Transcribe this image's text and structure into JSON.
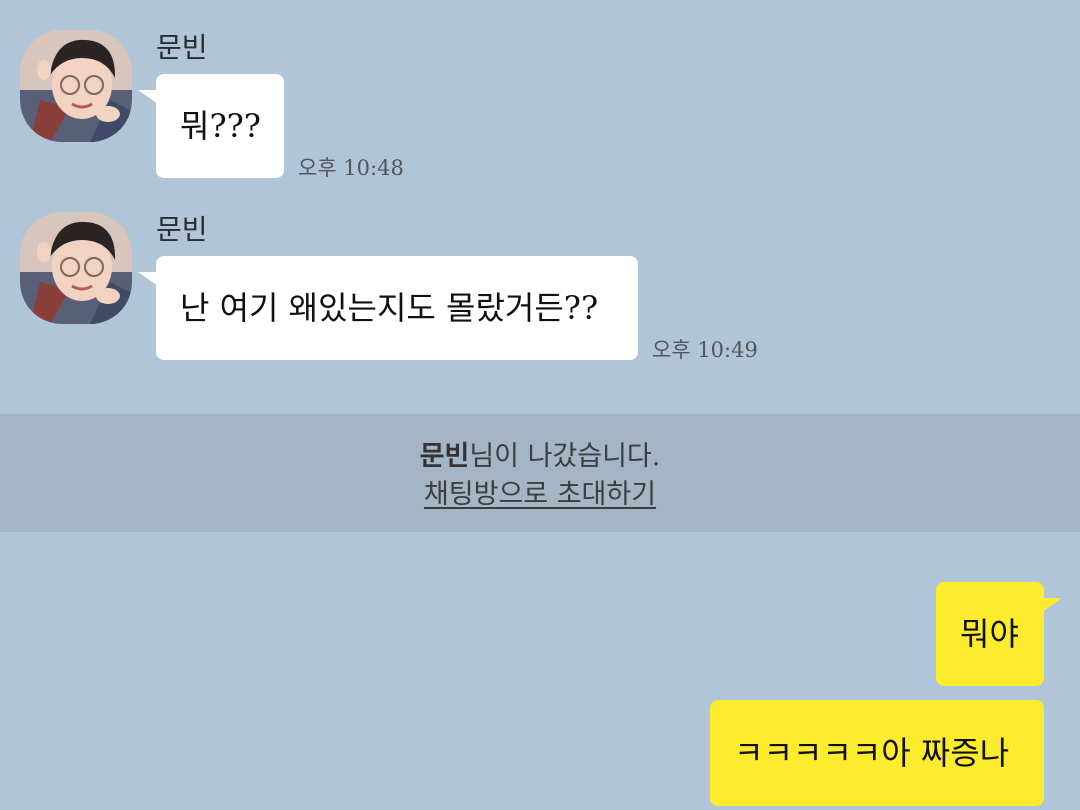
{
  "messages": [
    {
      "sender": "문빈",
      "text": "뭐???",
      "time": "오후 10:48"
    },
    {
      "sender": "문빈",
      "text": "난 여기 왜있는지도 몰랐거든??",
      "time": "오후 10:49"
    }
  ],
  "system_notice": {
    "name": "문빈",
    "suffix": "님이 나갔습니다.",
    "invite_label": "채팅방으로 초대하기"
  },
  "my_messages": [
    {
      "text": "뭐야"
    },
    {
      "text": "ㅋㅋㅋㅋㅋ아 짜증나"
    }
  ],
  "colors": {
    "background": "#b1c5d8",
    "system_band": "#a4b5c5",
    "my_bubble": "#fdec2e",
    "their_bubble": "#ffffff"
  },
  "icons": {
    "avatar": "profile-photo-avatar"
  }
}
